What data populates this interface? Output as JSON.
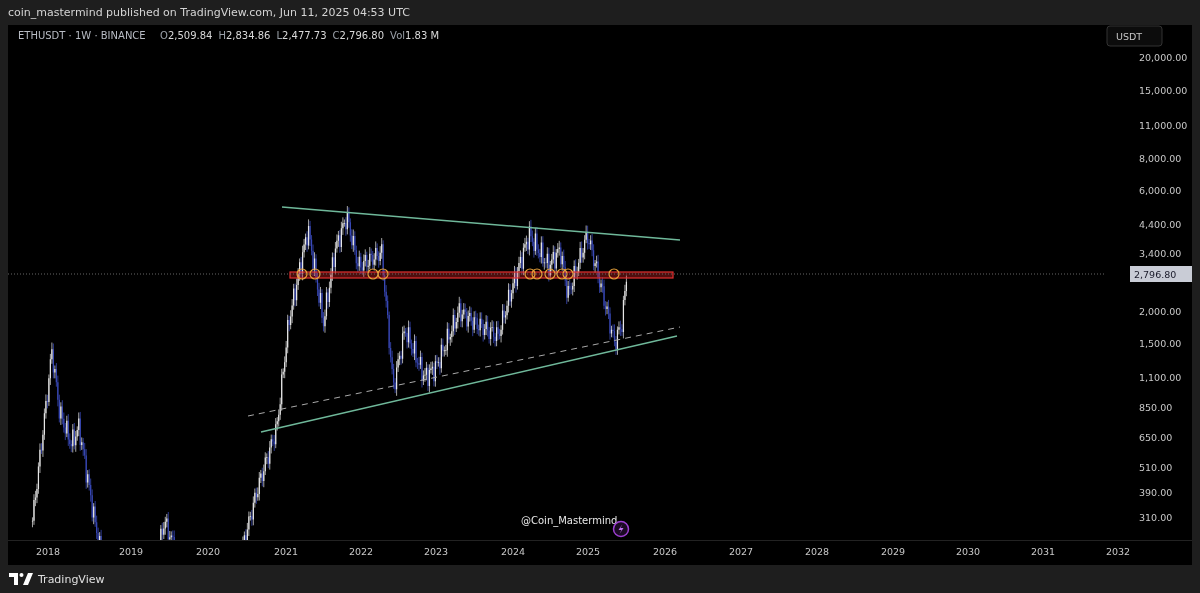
{
  "header": {
    "text": "coin_mastermind published on TradingView.com, Jun 11, 2025 04:53 UTC"
  },
  "legend": {
    "symbol": "ETHUSDT · 1W · BINANCE",
    "values": [
      {
        "label": "O",
        "value": "2,509.84"
      },
      {
        "label": "H",
        "value": "2,834.86"
      },
      {
        "label": "L",
        "value": "2,477.73"
      },
      {
        "label": "C",
        "value": "2,796.80"
      },
      {
        "label": "Vol",
        "value": "1.83 M"
      }
    ]
  },
  "price_axis": {
    "currency": "USDT",
    "labels": [
      "20,000.00",
      "15,000.00",
      "11,000.00",
      "8,000.00",
      "6,000.00",
      "4,400.00",
      "3,400.00",
      "2,000.00",
      "1,500.00",
      "1,100.00",
      "850.00",
      "650.00",
      "510.00",
      "390.00",
      "310.00"
    ],
    "last_price": "2,796.80"
  },
  "time_axis": {
    "labels": [
      "2018",
      "2019",
      "2020",
      "2021",
      "2022",
      "2023",
      "2024",
      "2025",
      "2026",
      "2027",
      "2028",
      "2029",
      "2030",
      "2031",
      "2032"
    ]
  },
  "chart": {
    "signature": "@Coin_Mastermind"
  },
  "footer": {
    "brand": "TradingView"
  }
}
